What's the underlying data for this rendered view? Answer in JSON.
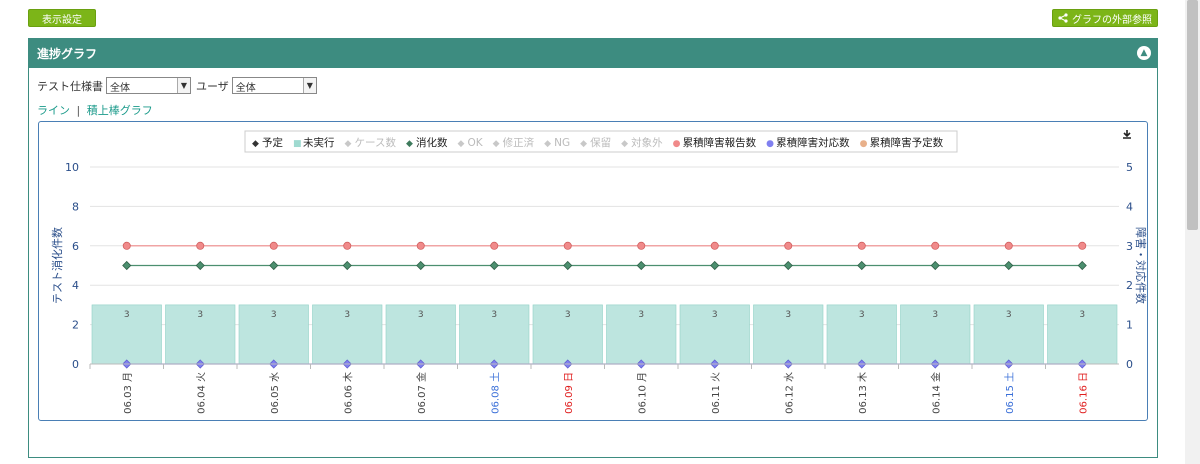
{
  "toolbar": {
    "display_settings": "表示設定",
    "external_ref": "グラフの外部参照"
  },
  "panel": {
    "title": "進捗グラフ"
  },
  "filters": {
    "spec_label": "テスト仕様書",
    "spec_value": "全体",
    "user_label": "ユーザ",
    "user_value": "全体"
  },
  "views": {
    "line": "ライン",
    "separator": "|",
    "stacked": "積上棒グラフ"
  },
  "colors": {
    "teal": "#3d8c80",
    "bar": "#bde5df",
    "pink": "#f08a8a",
    "green": "#4c8f6f",
    "blue": "#8080f0",
    "sat": "#3a6fd8",
    "sun": "#e02020"
  },
  "chart_data": {
    "type": "bar",
    "legend": [
      {
        "label": "予定",
        "marker": "◆",
        "color": "#333333",
        "active": true
      },
      {
        "label": "未実行",
        "marker": "■",
        "color": "#9fdad0",
        "active": true
      },
      {
        "label": "ケース数",
        "marker": "◆",
        "color": "#c8c8c8",
        "active": false
      },
      {
        "label": "消化数",
        "marker": "◆",
        "color": "#3d7a5c",
        "active": true
      },
      {
        "label": "OK",
        "marker": "◆",
        "color": "#c8c8c8",
        "active": false
      },
      {
        "label": "修正済",
        "marker": "◆",
        "color": "#c8c8c8",
        "active": false
      },
      {
        "label": "NG",
        "marker": "◆",
        "color": "#c8c8c8",
        "active": false
      },
      {
        "label": "保留",
        "marker": "◆",
        "color": "#c8c8c8",
        "active": false
      },
      {
        "label": "対象外",
        "marker": "◆",
        "color": "#c8c8c8",
        "active": false
      },
      {
        "label": "累積障害報告数",
        "marker": "●",
        "color": "#f08a8a",
        "active": true
      },
      {
        "label": "累積障害対応数",
        "marker": "●",
        "color": "#8080f0",
        "active": true
      },
      {
        "label": "累積障害予定数",
        "marker": "●",
        "color": "#e8b08a",
        "active": true
      }
    ],
    "categories": [
      {
        "date": "06.03",
        "day": "月",
        "kind": "weekday"
      },
      {
        "date": "06.04",
        "day": "火",
        "kind": "weekday"
      },
      {
        "date": "06.05",
        "day": "水",
        "kind": "weekday"
      },
      {
        "date": "06.06",
        "day": "木",
        "kind": "weekday"
      },
      {
        "date": "06.07",
        "day": "金",
        "kind": "weekday"
      },
      {
        "date": "06.08",
        "day": "土",
        "kind": "sat"
      },
      {
        "date": "06.09",
        "day": "日",
        "kind": "sun"
      },
      {
        "date": "06.10",
        "day": "月",
        "kind": "weekday"
      },
      {
        "date": "06.11",
        "day": "火",
        "kind": "weekday"
      },
      {
        "date": "06.12",
        "day": "水",
        "kind": "weekday"
      },
      {
        "date": "06.13",
        "day": "木",
        "kind": "weekday"
      },
      {
        "date": "06.14",
        "day": "金",
        "kind": "weekday"
      },
      {
        "date": "06.15",
        "day": "土",
        "kind": "sat"
      },
      {
        "date": "06.16",
        "day": "日",
        "kind": "sun"
      }
    ],
    "series": [
      {
        "name": "未実行",
        "kind": "bar",
        "axis": "left",
        "values": [
          3,
          3,
          3,
          3,
          3,
          3,
          3,
          3,
          3,
          3,
          3,
          3,
          3,
          3
        ],
        "labels": true
      },
      {
        "name": "消化数",
        "kind": "line",
        "axis": "left",
        "values": [
          5,
          5,
          5,
          5,
          5,
          5,
          5,
          5,
          5,
          5,
          5,
          5,
          5,
          5
        ]
      },
      {
        "name": "累積障害報告数",
        "kind": "line",
        "axis": "right",
        "values": [
          3,
          3,
          3,
          3,
          3,
          3,
          3,
          3,
          3,
          3,
          3,
          3,
          3,
          3
        ]
      },
      {
        "name": "累積障害対応数",
        "kind": "line",
        "axis": "right",
        "values": [
          0,
          0,
          0,
          0,
          0,
          0,
          0,
          0,
          0,
          0,
          0,
          0,
          0,
          0
        ]
      }
    ],
    "ylabel": "テスト消化件数",
    "y2label": "障害・対応件数",
    "ylim": [
      0,
      10
    ],
    "yticks": [
      0,
      2,
      4,
      6,
      8,
      10
    ],
    "y2lim": [
      0,
      5
    ],
    "y2ticks": [
      0,
      1,
      2,
      3,
      4,
      5
    ],
    "grid": true,
    "legend_position": "top"
  }
}
